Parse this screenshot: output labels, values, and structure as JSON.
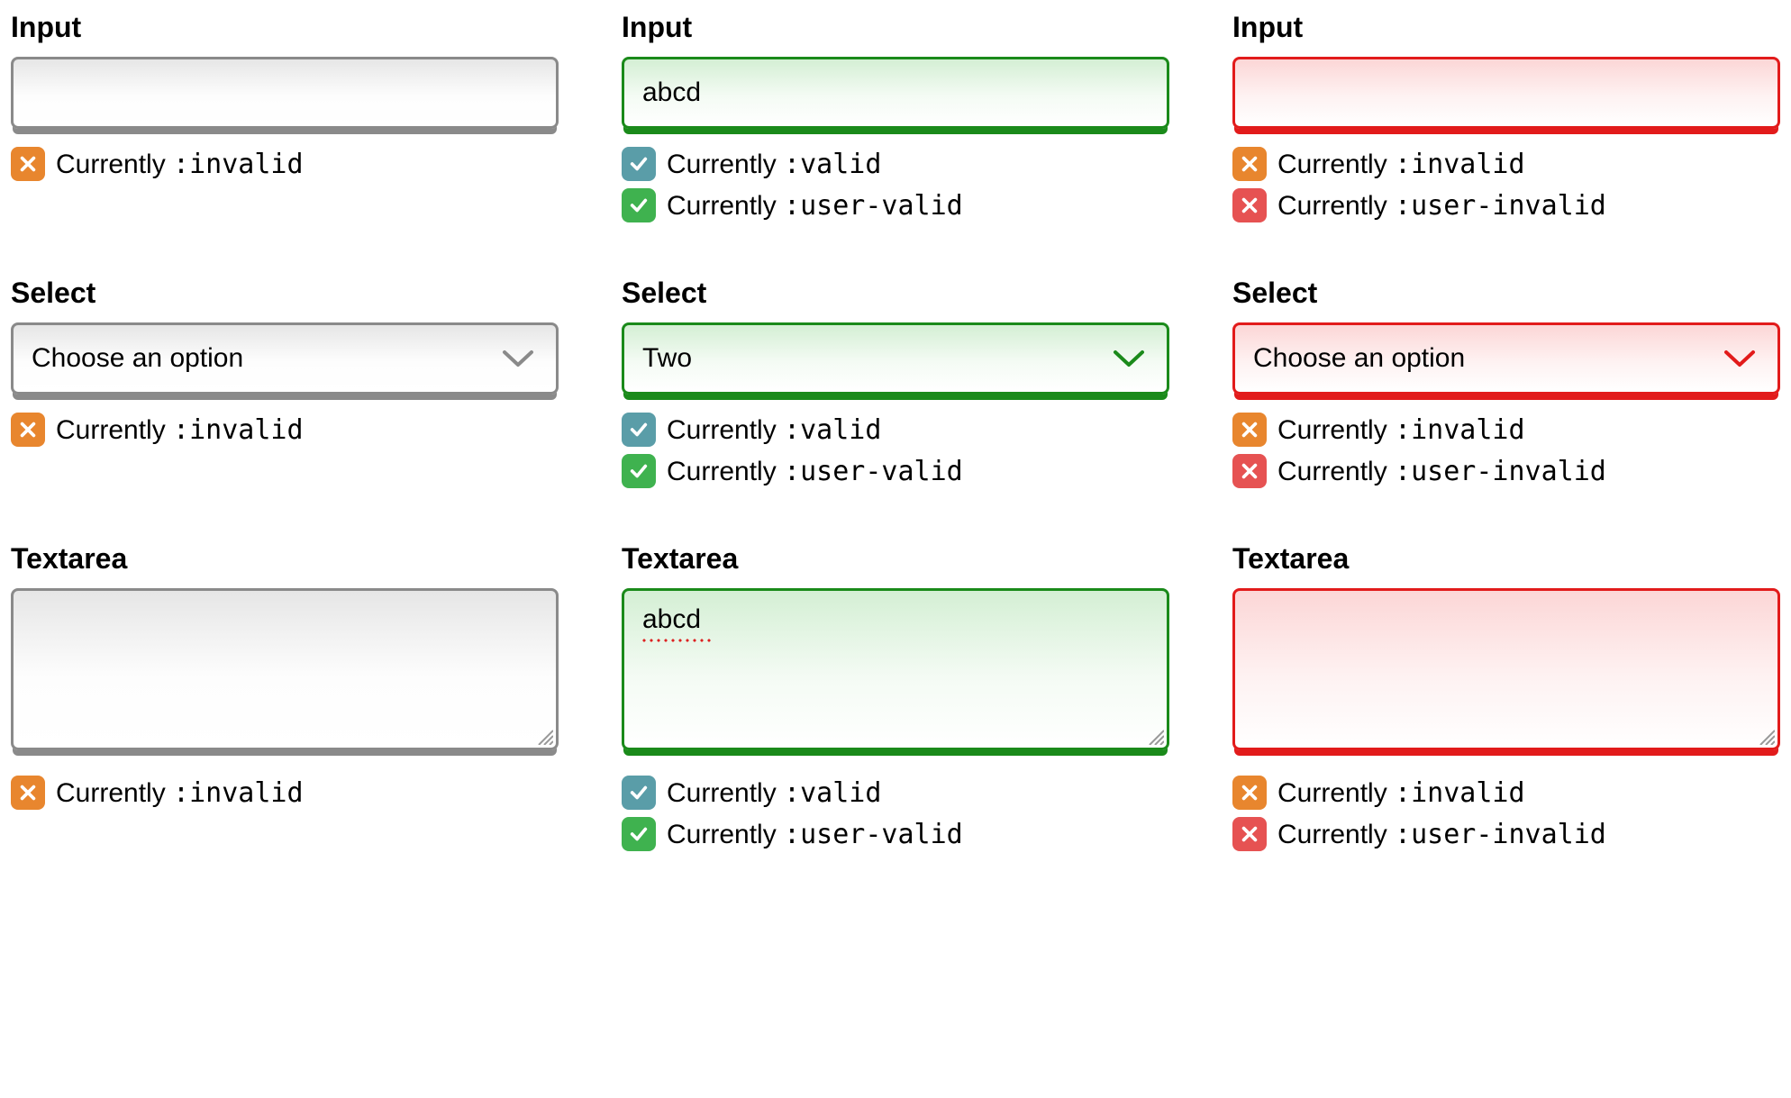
{
  "labels": {
    "input": "Input",
    "select": "Select",
    "textarea": "Textarea"
  },
  "placeholders": {
    "choose": "Choose an option"
  },
  "values": {
    "abcd": "abcd",
    "two": "Two",
    "empty": ""
  },
  "status": {
    "prefix": "Currently ",
    "invalid": ":invalid",
    "valid": ":valid",
    "user_valid": ":user-valid",
    "user_invalid": ":user-invalid"
  },
  "colors": {
    "neutral_border": "#8a8a8a",
    "valid_border": "#1a8a1a",
    "invalid_border": "#e21b1b",
    "orange_badge": "#e8862e",
    "teal_badge": "#5a9da8",
    "green_badge": "#3fb24f",
    "red_badge": "#e65252"
  },
  "icons": {
    "cross": "cross-icon",
    "check": "check-icon",
    "chevron_down": "chevron-down-icon",
    "resize": "resize-handle-icon"
  }
}
